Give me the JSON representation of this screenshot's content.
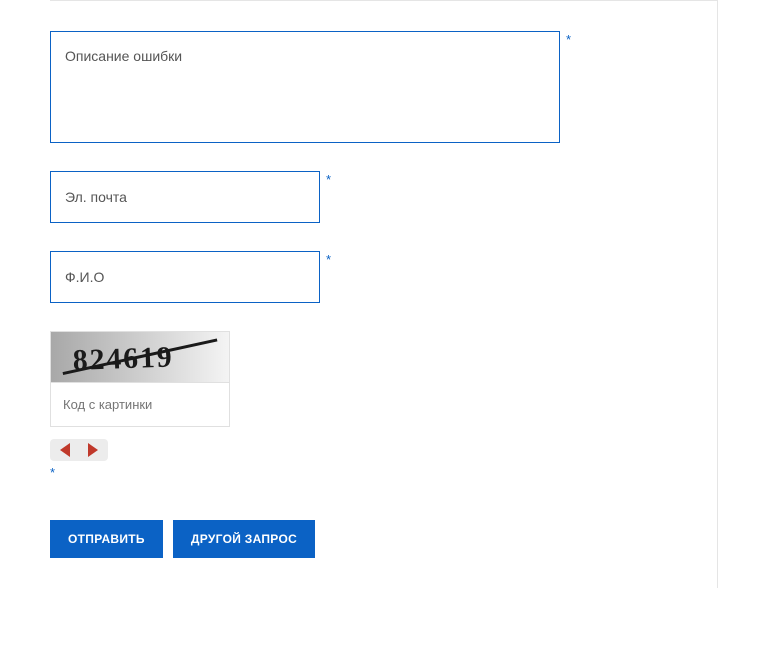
{
  "required_mark": "*",
  "fields": {
    "description": {
      "placeholder": "Описание ошибки",
      "value": ""
    },
    "email": {
      "placeholder": "Эл. почта",
      "value": ""
    },
    "fullname": {
      "placeholder": "Ф.И.О",
      "value": ""
    },
    "captcha": {
      "placeholder": "Код с картинки",
      "value": "",
      "image_text": "824619"
    }
  },
  "buttons": {
    "submit": "ОТПРАВИТЬ",
    "other_request": "ДРУГОЙ ЗАПРОС"
  }
}
